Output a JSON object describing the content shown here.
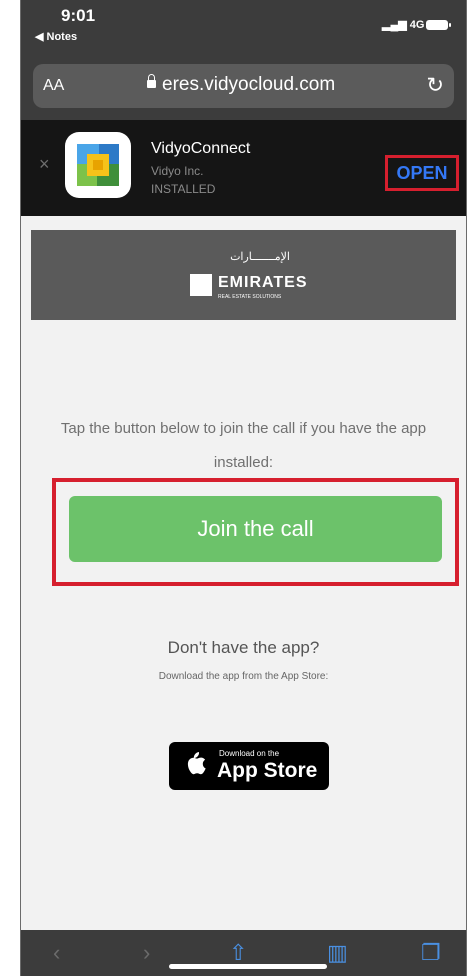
{
  "status_bar": {
    "time": "9:01",
    "back_app": "◀ Notes",
    "network": "4G"
  },
  "address_bar": {
    "text_size_label": "AA",
    "domain": "eres.vidyocloud.com"
  },
  "smart_banner": {
    "app_name": "VidyoConnect",
    "developer": "Vidyo Inc.",
    "status": "INSTALLED",
    "open_label": "OPEN"
  },
  "page_header": {
    "logo_arabic": "الإمـــــــارات",
    "logo_name": "EMIRATES",
    "logo_sub": "REAL ESTATE SOLUTIONS"
  },
  "main": {
    "instructions": "Tap the button below to join the call if you have the app installed:",
    "join_label": "Join the call",
    "no_app_heading": "Don't have the app?",
    "download_hint": "Download the app from the App Store:",
    "appstore_top": "Download on the",
    "appstore_main": "App Store"
  },
  "colors": {
    "join_button": "#6cc26a",
    "highlight_border": "#d61f2e",
    "open_text": "#3478f6"
  }
}
